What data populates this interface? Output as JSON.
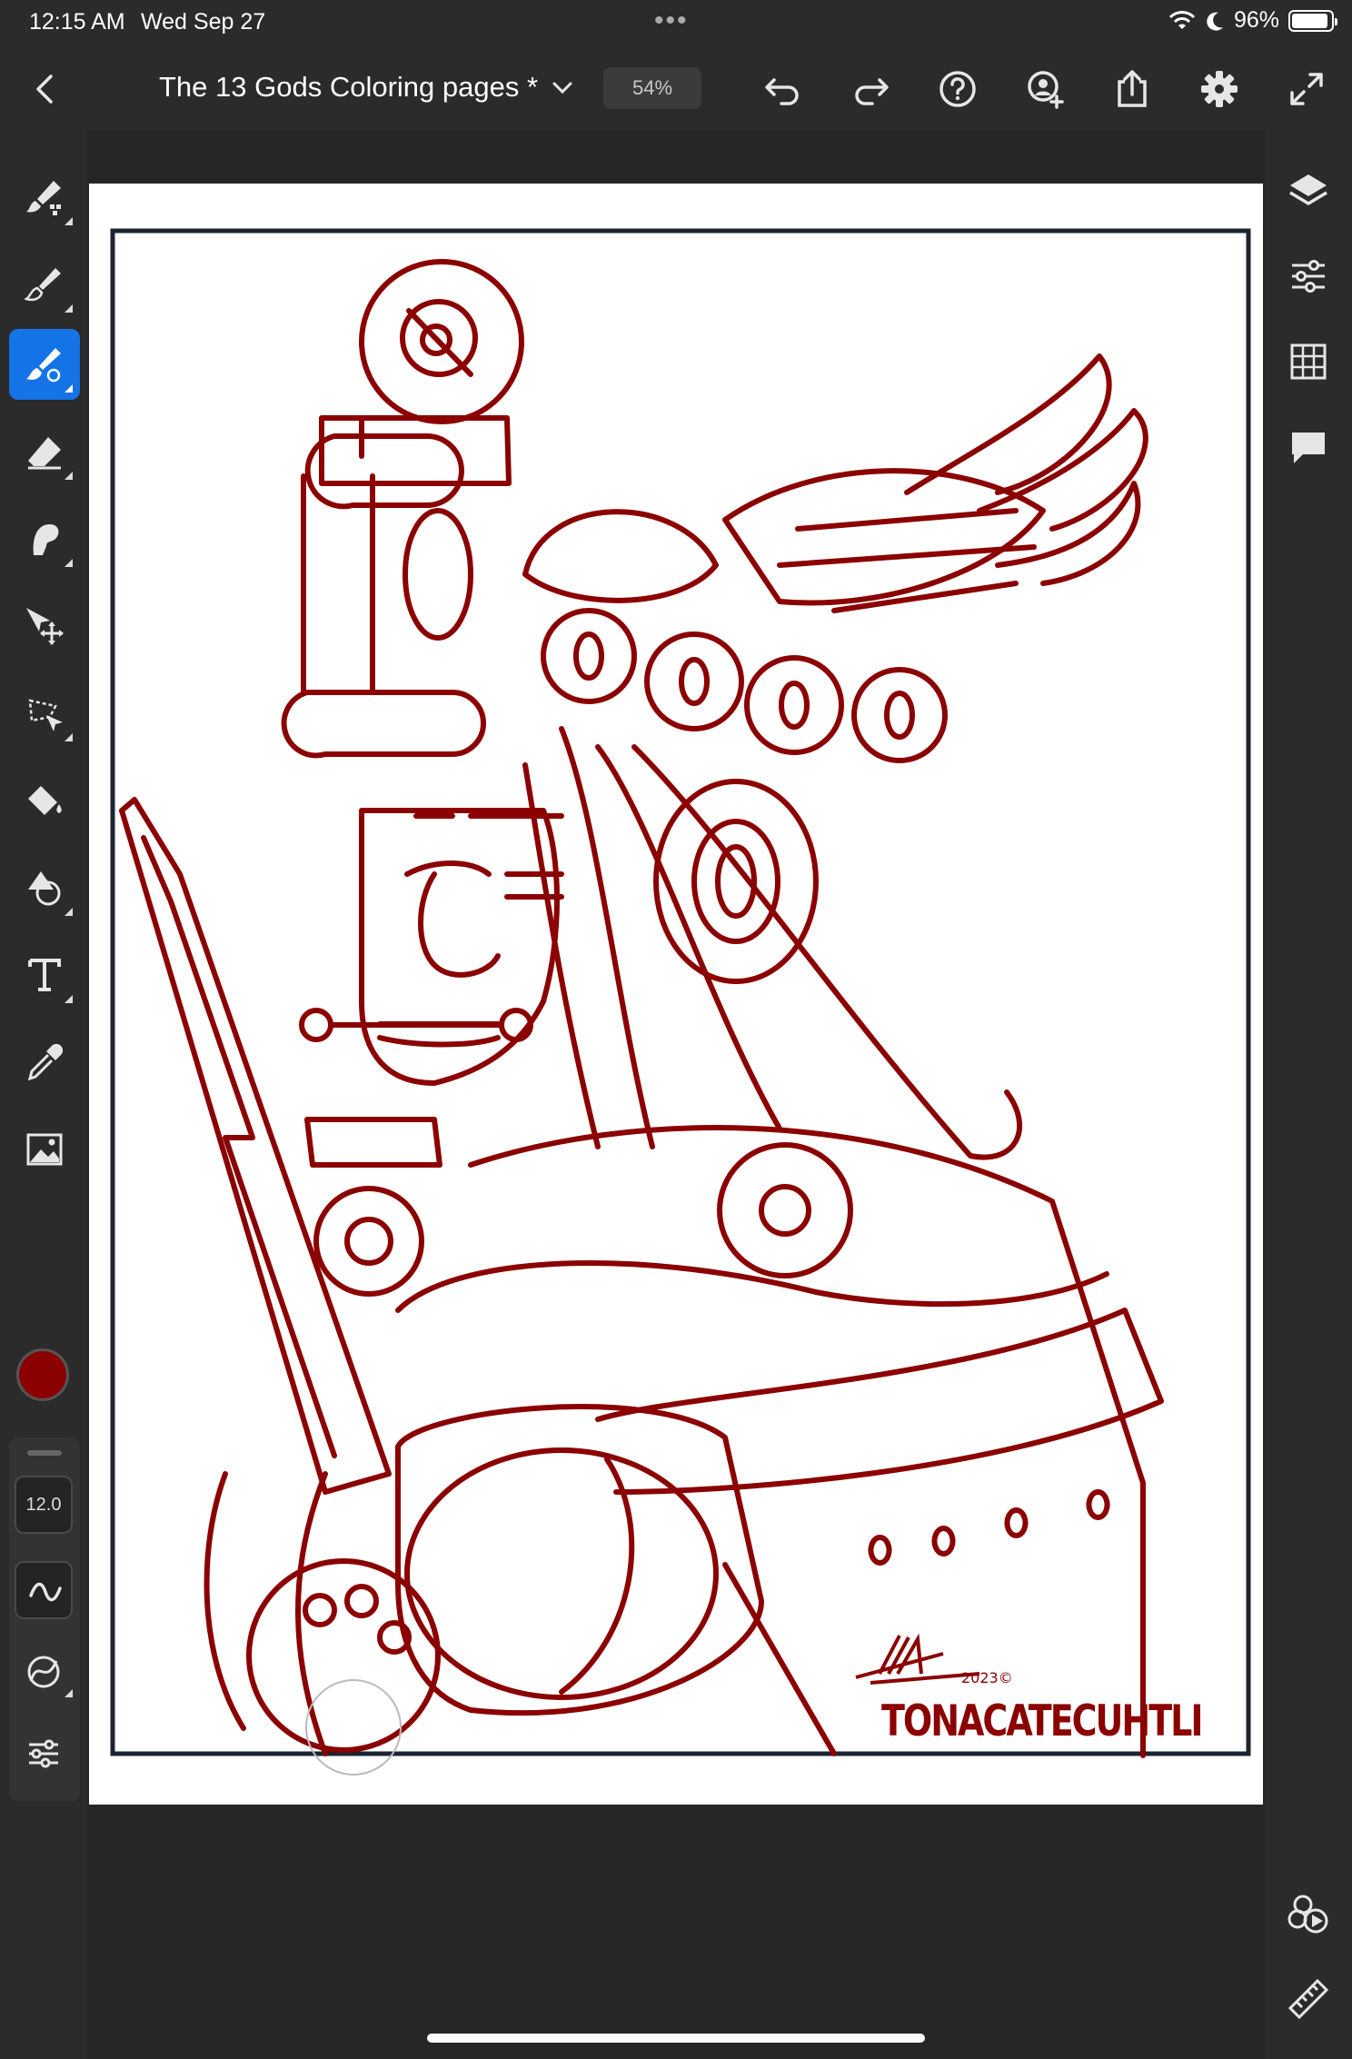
{
  "status_bar": {
    "time": "12:15 AM",
    "date": "Wed Sep 27",
    "dots": "•••",
    "battery": "96%"
  },
  "toolbar": {
    "document_title": "The 13 Gods Coloring pages *",
    "zoom": "54%"
  },
  "tools": [
    {
      "name": "pixel-brush",
      "active": false
    },
    {
      "name": "live-brush",
      "active": false
    },
    {
      "name": "vector-brush",
      "active": true
    },
    {
      "name": "eraser",
      "active": false
    },
    {
      "name": "smudge",
      "active": false
    },
    {
      "name": "transform",
      "active": false
    },
    {
      "name": "selection",
      "active": false
    },
    {
      "name": "fill",
      "active": false
    },
    {
      "name": "shapes",
      "active": false
    },
    {
      "name": "text",
      "active": false
    },
    {
      "name": "eyedropper",
      "active": false
    },
    {
      "name": "place-image",
      "active": false
    }
  ],
  "brush": {
    "color": "#8b0000",
    "size": "12.0"
  },
  "artwork": {
    "signature": "TONACATECUHTLI",
    "year_mark": "2023©",
    "line_color": "#8b0000",
    "frame_color": "#1c2433"
  }
}
